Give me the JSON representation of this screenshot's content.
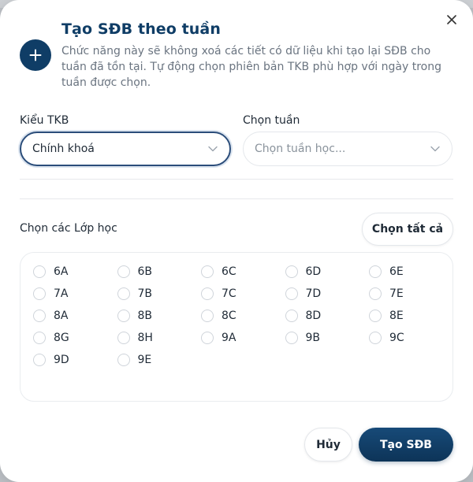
{
  "dialog": {
    "title": "Tạo SĐB theo tuần",
    "description": "Chức năng này sẽ không xoá các tiết có dữ liệu khi tạo lại SĐB cho tuần đã tồn tại. Tự động chọn phiên bản TKB phù hợp với ngày trong tuần được chọn."
  },
  "form": {
    "schedule_type": {
      "label": "Kiểu TKB",
      "value": "Chính khoá"
    },
    "week": {
      "label": "Chọn tuần",
      "placeholder": "Chọn tuần học..."
    }
  },
  "classes": {
    "label": "Chọn các Lớp học",
    "select_all_label": "Chọn tất cả",
    "items": [
      "6A",
      "6B",
      "6C",
      "6D",
      "6E",
      "7A",
      "7B",
      "7C",
      "7D",
      "7E",
      "8A",
      "8B",
      "8C",
      "8D",
      "8E",
      "8G",
      "8H",
      "9A",
      "9B",
      "9C",
      "9D",
      "9E"
    ]
  },
  "actions": {
    "cancel_label": "Hủy",
    "submit_label": "Tạo SĐB"
  },
  "colors": {
    "primary": "#0f3d66",
    "text": "#1f2a36",
    "muted": "#6a7480",
    "border": "#e4e7eb"
  }
}
